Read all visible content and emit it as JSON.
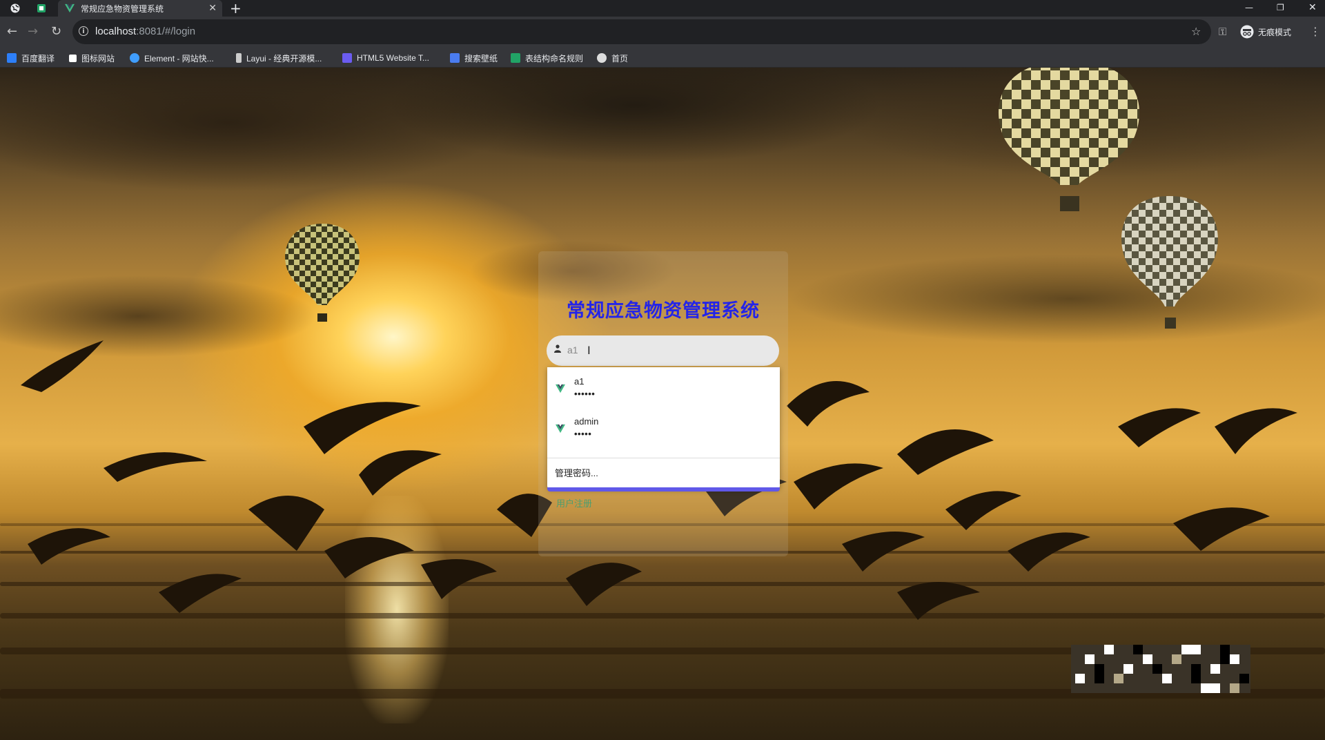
{
  "browser": {
    "tab_title": "常规应急物资管理系统",
    "url_host": "localhost",
    "url_rest": ":8081/#/login",
    "incognito_label": "无痕模式",
    "bookmarks": [
      {
        "label": "百度翻译",
        "icon": "baidu-translate-icon",
        "color": "#2d7ff9"
      },
      {
        "label": "图标网站",
        "icon": "flag-icon",
        "color": "#ffffff"
      },
      {
        "label": "Element - 网站快...",
        "icon": "element-icon",
        "color": "#409eff"
      },
      {
        "label": "Layui - 经典开源模...",
        "icon": "layui-icon",
        "color": "#cccccc"
      },
      {
        "label": "HTML5 Website T...",
        "icon": "html5-template-icon",
        "color": "#6b5cf0"
      },
      {
        "label": "搜索壁纸",
        "icon": "wallpaper-icon",
        "color": "#4a7cf0"
      },
      {
        "label": "表结构命名规则",
        "icon": "sheet-icon",
        "color": "#21a366"
      },
      {
        "label": "首页",
        "icon": "globe-icon",
        "color": "#dddddd"
      }
    ]
  },
  "login": {
    "title": "常规应急物资管理系统",
    "username_value": "a1",
    "register_link": "用户注册"
  },
  "autofill": {
    "entries": [
      {
        "username": "a1",
        "password_mask": "••••••"
      },
      {
        "username": "admin",
        "password_mask": "•••••"
      }
    ],
    "manage_label": "管理密码..."
  },
  "colors": {
    "title": "#2424e8",
    "register": "#2fa07a",
    "button": "#6058e8",
    "vue_green": "#41b883"
  }
}
